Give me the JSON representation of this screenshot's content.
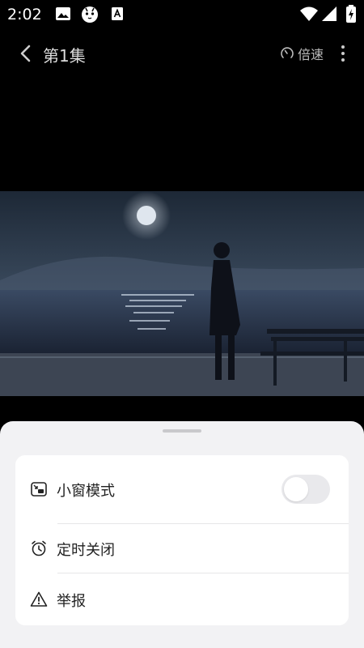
{
  "status_bar": {
    "time": "2:02"
  },
  "header": {
    "title": "第1集",
    "speed_label": "倍速"
  },
  "menu": {
    "items": [
      {
        "label": "小窗模式",
        "icon": "pip-icon",
        "toggle_on": false
      },
      {
        "label": "定时关闭",
        "icon": "alarm-icon"
      },
      {
        "label": "举报",
        "icon": "warning-icon"
      }
    ]
  },
  "colors": {
    "sheet_bg": "#f2f2f4",
    "card_bg": "#ffffff",
    "toggle_off": "#e9e9ec"
  }
}
